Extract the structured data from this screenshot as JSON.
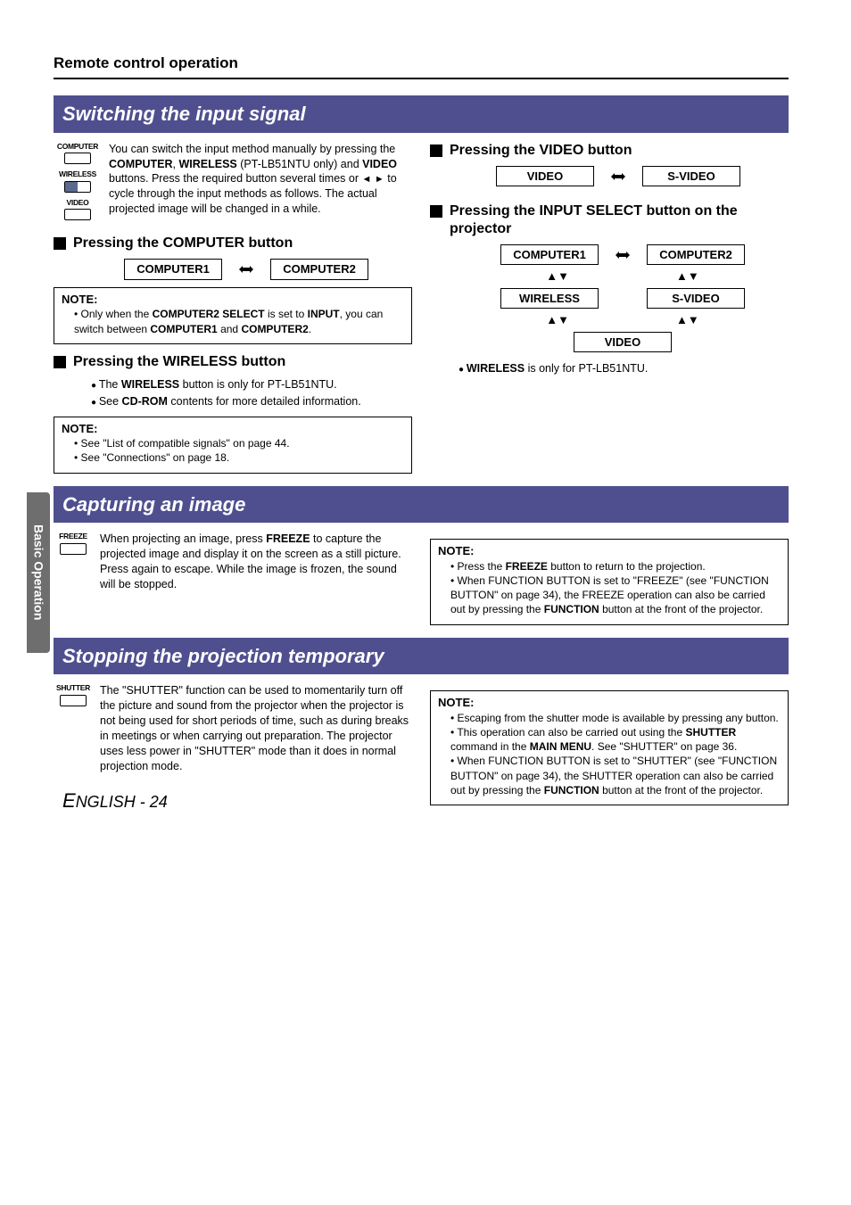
{
  "sideTab": "Basic Operation",
  "topicTitle": "Remote control operation",
  "footer": {
    "e": "E",
    "rest": "NGLISH",
    "page": " - 24"
  },
  "sec1": {
    "bar": "Switching the input signal",
    "intro_pre": "You can switch the input method manually by pressing the ",
    "k1": "COMPUTER",
    "sep1": ", ",
    "k2": "WIRELESS",
    "intro_mid1": " (PT-LB51NTU only) and ",
    "k3": "VIDEO",
    "intro_mid2": " buttons. Press the required button several times or ",
    "tri_l": "◄",
    "tri_r": "►",
    "intro_post": " to cycle through the input methods as follows. The actual projected image will be changed in a while.",
    "hComputer": "Pressing the COMPUTER button",
    "box_c1": "COMPUTER1",
    "box_c2": "COMPUTER2",
    "note1_title": "NOTE:",
    "note1_li1_pre": "Only when the ",
    "note1_li1_b1": "COMPUTER2 SELECT",
    "note1_li1_mid": " is set to ",
    "note1_li1_b2": "INPUT",
    "note1_li1_post": ", you can switch between ",
    "note1_li1_b3": "COMPUTER1",
    "note1_li1_and": " and ",
    "note1_li1_b4": "COMPUTER2",
    "note1_li1_dot": ".",
    "hWireless": "Pressing the WIRELESS button",
    "wb1_pre": "The ",
    "wb1_b": "WIRELESS",
    "wb1_post": " button is only for PT-LB51NTU.",
    "wb2_pre": "See ",
    "wb2_b": "CD-ROM",
    "wb2_post": " contents for more detailed information.",
    "hVideo": "Pressing the VIDEO button",
    "box_v1": "VIDEO",
    "box_v2": "S-VIDEO",
    "hInputSelect": "Pressing the INPUT SELECT button on the projector",
    "isel_c1": "COMPUTER1",
    "isel_c2": "COMPUTER2",
    "isel_w": "WIRELESS",
    "isel_sv": "S-VIDEO",
    "isel_v": "VIDEO",
    "isel_bullet_b": "WIRELESS",
    "isel_bullet_post": " is only for PT-LB51NTU.",
    "note2_title": "NOTE:",
    "note2_li1": "See \"List of compatible signals\" on page 44.",
    "note2_li2": "See \"Connections\" on page 18.",
    "iconLabels": {
      "computer": "COMPUTER",
      "wireless": "WIRELESS",
      "video": "VIDEO"
    }
  },
  "sec2": {
    "bar": "Capturing an image",
    "iconLabel": "FREEZE",
    "p_pre": "When projecting an image, press ",
    "p_b": "FREEZE",
    "p_post": " to capture the projected image and display it on the screen as a still picture. Press again to escape. While the image is frozen, the sound will be stopped.",
    "note_title": "NOTE:",
    "li1_pre": "Press the ",
    "li1_b": "FREEZE",
    "li1_post": " button to return to the projection.",
    "li2_pre": "When FUNCTION BUTTON is set to \"FREEZE\" (see \"FUNCTION BUTTON\" on page 34), the FREEZE operation can also be carried out by pressing the ",
    "li2_b": "FUNCTION",
    "li2_post": " button at the front of the projector."
  },
  "sec3": {
    "bar": "Stopping the projection temporary",
    "iconLabel": "SHUTTER",
    "p": "The \"SHUTTER\" function can be used to momentarily turn off the picture and sound from the projector when the projector is not being used for short periods of time, such as during breaks in meetings or when carrying out preparation. The projector uses less power in \"SHUTTER\" mode than it does in normal projection mode.",
    "note_title": "NOTE:",
    "li1": "Escaping from the shutter mode is available by pressing any button.",
    "li2_pre": "This operation can also be carried out using the ",
    "li2_b1": "SHUTTER",
    "li2_mid": " command in the ",
    "li2_b2": "MAIN MENU",
    "li2_post": ". See \"SHUTTER\" on page 36.",
    "li3_pre": "When FUNCTION BUTTON is set to \"SHUTTER\" (see \"FUNCTION BUTTON\" on page 34), the SHUTTER operation can also be carried out by pressing the ",
    "li3_b": "FUNCTION",
    "li3_post": " button at the front of the projector."
  }
}
